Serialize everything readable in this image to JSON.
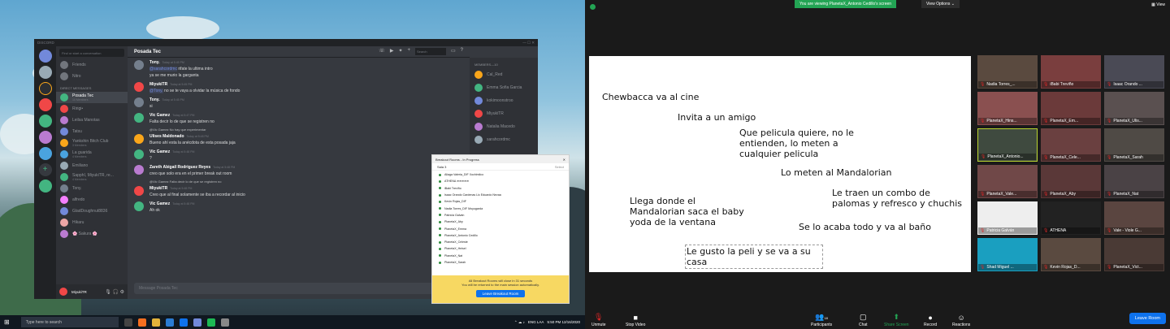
{
  "discord": {
    "app_title": "DISCORD",
    "search_placeholder": "Find or start a conversation",
    "friends": "Friends",
    "nitro": "Nitro",
    "dm_header": "DIRECT MESSAGES",
    "dms": [
      {
        "name": "Posada Tec",
        "sub": "10 Members",
        "color": "#43b581"
      },
      {
        "name": "Ririgi•",
        "sub": "",
        "color": "#f04747"
      },
      {
        "name": "Leilsa Manotas",
        "sub": "",
        "color": "#b97bd0"
      },
      {
        "name": "Tatsu",
        "sub": "",
        "color": "#7289da"
      },
      {
        "name": "Yankshin Bitch Club",
        "sub": "3 Members",
        "color": "#faa61a"
      },
      {
        "name": "La guarida",
        "sub": "4 Members",
        "color": "#4aa3df"
      },
      {
        "name": "Emiliano",
        "sub": "",
        "color": "#99aab5"
      },
      {
        "name": "SapphI, MiyukiTR, re...",
        "sub": "4 Members",
        "color": "#43b581"
      },
      {
        "name": "Tony.",
        "sub": "",
        "color": "#747f8d"
      },
      {
        "name": "alfredo",
        "sub": "",
        "color": "#f47fff"
      },
      {
        "name": "GladDoughnut8836",
        "sub": "",
        "color": "#7289da"
      },
      {
        "name": "Hikaru",
        "sub": "",
        "color": "#eda6a6"
      },
      {
        "name": "🌸 Sakura 🌸",
        "sub": "",
        "color": "#b97bd0"
      }
    ],
    "user": {
      "name": "MiyukiTR",
      "tag": "#8153"
    },
    "channel": "Posada Tec",
    "search_box": "Search",
    "messages": [
      {
        "author": "Tony.",
        "time": "Today at 5:45 PM",
        "mention": "@sarahcordmc",
        "text": " rifate la ultima intro",
        "text2": "ya se me murio la garganta",
        "color": "#747f8d"
      },
      {
        "author": "MiyukiTR",
        "time": "Today at 5:45 PM",
        "mention": "@Tony.",
        "text": " no se te vaya a olvidar la música de fondo",
        "text2": "",
        "color": "#f04747"
      },
      {
        "author": "Tony.",
        "time": "Today at 5:45 PM",
        "mention": "",
        "text": "si",
        "text2": "",
        "color": "#747f8d"
      },
      {
        "author": "Vic Gamez",
        "time": "Today at 5:47 PM",
        "mention": "",
        "text": "Falta decir lo de que se registren no",
        "text2": "",
        "color": "#43b581"
      },
      {
        "author": "Ulises Maldonado",
        "time": "Today at 5:48 PM",
        "mention": "",
        "text": "Bueno ahí esta la anécdota de esta posada jaja",
        "text2": "",
        "reply": "@Vic Gamez No hay que experimentar",
        "color": "#faa61a"
      },
      {
        "author": "Vic Gamez",
        "time": "Today at 5:48 PM",
        "mention": "",
        "text": "?",
        "text2": "",
        "color": "#43b581"
      },
      {
        "author": "Zareth Abigail Rodriguez Reyes",
        "time": "Today at 5:48 PM",
        "mention": "",
        "text": "creo que solo era en el primer break out room",
        "text2": "",
        "color": "#b97bd0"
      },
      {
        "author": "MiyukiTR",
        "time": "Today at 5:48 PM",
        "mention": "",
        "text": "Creo que al final solamente se iba a recordar al inicio",
        "text2": "",
        "reply": "@Vic Gamez Falta decir lo de que se registren no",
        "color": "#f04747"
      },
      {
        "author": "Vic Gamez",
        "time": "Today at 5:48 PM",
        "mention": "",
        "text": "Ah ok",
        "text2": "",
        "color": "#43b581"
      }
    ],
    "input_placeholder": "Message Posada Tec",
    "members_header": "MEMBERS—10",
    "members": [
      "Cal_Red",
      "Emma Sofia Garcia",
      "kokimoonstroo",
      "MiyukiTR",
      "Natalia Macedo",
      "sarahcordmc"
    ]
  },
  "breakout": {
    "title": "Breakout Rooms - In Progress",
    "room": "Sala 3",
    "room_action": "Select",
    "participants": [
      "Aliaga Valeria_DIF Xochimilco",
      "ATHENA ≋≋≋≋≋",
      "iBabi Treviño",
      "Isaac Orando Cardenas Lic Eduardo Nevaa",
      "Kevin Rojas_DIF",
      "Nadia Torres_DIF Moyugarda",
      "Patricia Galván",
      "PlanetaX_Aby",
      "PlanetaX_Emma",
      "PlanetaX_Antonio Cedillo",
      "PlanetaX_Celeste",
      "PlanetaX_Heisel",
      "PlanetaX_Nat",
      "PlanetaX_Sarah"
    ],
    "notice": "All Breakout Rooms will close in 31 seconds",
    "notice2": "You will be returned to the main session automatically.",
    "leave": "Leave Breakout Room"
  },
  "taskbar": {
    "search": "Type here to search",
    "lang": "ENG LAA",
    "time": "5:50 PM",
    "date": "12/16/2020"
  },
  "zoom": {
    "banner": "You are viewing PlanetaX_Antonio Cedillo's screen",
    "view_options": "View Options ⌄",
    "view": "View",
    "slide": [
      "Chewbacca va al cine",
      "Invita a un amigo",
      "Que pelicula quiere, no le entienden, lo meten a cualquier pelicula",
      "Lo meten al Mandalorian",
      "Llega donde el Mandalorian saca el baby yoda de la ventana",
      "Le traen un combo de palomas y refresco y chuchis",
      "Se lo acaba todo y va al baño",
      "Le gusto la peli y se va a su casa"
    ],
    "tiles": [
      "Nadia Torres_...",
      "iBabi Treviño",
      "Isaac Orando ...",
      "PlanetaX_Hins...",
      "PlanetaX_Em...",
      "PlanetaX_Ulis...",
      "PlanetaX_Antonio...",
      "PlanetaX_Cele...",
      "PlanetaX_Sarah",
      "PlanetaX_Vale...",
      "PlanetaX_Aby",
      "PlanetaX_Nat",
      "Patricia Galván",
      "ATHENA",
      "Vale - Viole G...",
      "Shad Miguel ...",
      "Kevin Rojas_D...",
      "PlanetaX_Vict..."
    ],
    "toolbar": {
      "mute": "Unmute",
      "video": "Stop Video",
      "participants": "Participants",
      "participants_count": "18",
      "chat": "Chat",
      "share": "Share Screen",
      "record": "Record",
      "reactions": "Reactions",
      "leave": "Leave Room"
    }
  }
}
